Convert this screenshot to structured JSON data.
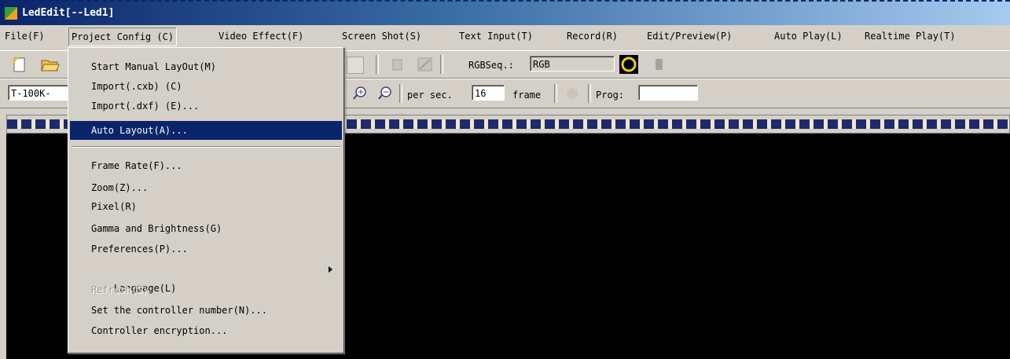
{
  "window": {
    "title": "LedEdit[--Led1]"
  },
  "menubar": {
    "items": [
      {
        "label": "File(F)"
      },
      {
        "label": "Project Config (C)"
      },
      {
        "label": "Video Effect(F)"
      },
      {
        "label": "Screen Shot(S)"
      },
      {
        "label": "Text Input(T)"
      },
      {
        "label": "Record(R)"
      },
      {
        "label": "Edit/Preview(P)"
      },
      {
        "label": "Auto Play(L)"
      },
      {
        "label": "Realtime Play(T)"
      }
    ]
  },
  "toolbar1": {
    "rgb_seq_label": "RGBSeq.:",
    "rgb_seq_value": "RGB"
  },
  "toolbar2": {
    "controller_value": "T-100K-",
    "per_sec_label": "per sec.",
    "frame_rate_value": "16",
    "frame_label": "frame",
    "prog_label": "Prog:",
    "prog_value": ""
  },
  "dropdown": {
    "items": [
      {
        "label": "Start Manual LayOut(M)"
      },
      {
        "label": "Import(.cxb) (C)"
      },
      {
        "label": "Import(.dxf) (E)..."
      },
      {
        "label": "Auto Layout(A)..."
      },
      {
        "label": "Frame Rate(F)..."
      },
      {
        "label": "Zoom(Z)..."
      },
      {
        "label": "Pixel(R)"
      },
      {
        "label": "Gamma and Brightness(G)"
      },
      {
        "label": "Preferences(P)..."
      },
      {
        "label": "Language(L)"
      },
      {
        "label": "Refresh(S)"
      },
      {
        "label": "Set the controller number(N)..."
      },
      {
        "label": "Controller encryption..."
      }
    ],
    "highlighted": "Auto Layout(A)...",
    "disabled": "Refresh(S)"
  },
  "colors": {
    "face": "#d4d0c8",
    "title_start": "#0a246a",
    "highlight": "#0a246a",
    "canvas": "#000000"
  },
  "icons": [
    "app-icon",
    "new-file-icon",
    "open-folder-icon",
    "zoom-in-icon",
    "zoom-out-icon",
    "color-wheel-icon",
    "submenu-arrow-icon"
  ]
}
